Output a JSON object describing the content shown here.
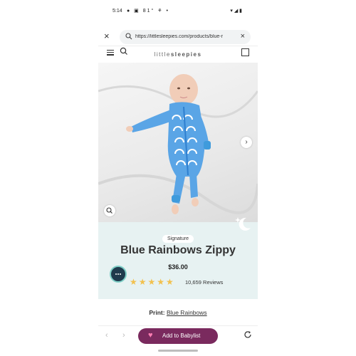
{
  "status_bar": {
    "time": "5:14",
    "notifications": "● ▣ 81° ⚘ •",
    "right_icons": "▾ ◢ ▮"
  },
  "browser": {
    "url": "https://littlesleepies.com/products/blue-r",
    "close_label": "×",
    "clear_label": "×"
  },
  "site": {
    "logo_prefix": "little",
    "logo_suffix": "sleepies"
  },
  "product": {
    "badge": "Signature",
    "title": "Blue Rainbows Zippy",
    "price": "$36.00",
    "stars": "★★★★★",
    "reviews": "10,659 Reviews",
    "print_label": "Print:",
    "print_value": "Blue Rainbows"
  },
  "bottom_bar": {
    "back_label": "‹",
    "forward_label": "›",
    "babylist_label": "Add to Babylist",
    "heart": "♥"
  },
  "colors": {
    "info_bg": "#e7f2f2",
    "babylist_bg": "#7a2a5e",
    "star": "#f2c14e",
    "garment_blue": "#5aa5e6"
  },
  "icons": [
    "search-icon",
    "menu-icon",
    "bag-icon",
    "zoom-icon",
    "next-arrow-icon",
    "chat-icon",
    "reload-icon",
    "heart-icon",
    "moon-icon"
  ]
}
